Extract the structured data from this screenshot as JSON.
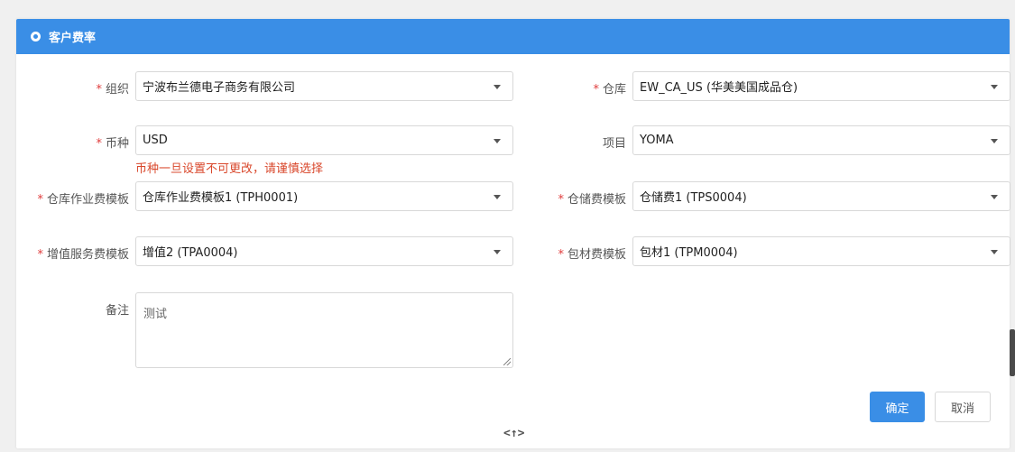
{
  "dialog": {
    "title": "客户费率",
    "icon": "circle-logo-icon"
  },
  "form": {
    "org": {
      "label": "组织",
      "required": true,
      "value": "宁波布兰德电子商务有限公司"
    },
    "warehouse": {
      "label": "仓库",
      "required": true,
      "value": "EW_CA_US (华美美国成品仓)"
    },
    "currency": {
      "label": "币种",
      "required": true,
      "value": "USD",
      "hint": "币种一旦设置不可更改，请谨慎选择"
    },
    "project": {
      "label": "项目",
      "required": false,
      "value": "YOMA"
    },
    "op_template": {
      "label": "仓库作业费模板",
      "required": true,
      "value": "仓库作业费模板1 (TPH0001)"
    },
    "storage_template": {
      "label": "仓储费模板",
      "required": true,
      "value": "仓储费1 (TPS0004)"
    },
    "vas_template": {
      "label": "增值服务费模板",
      "required": true,
      "value": "增值2 (TPA0004)"
    },
    "packing_template": {
      "label": "包材费模板",
      "required": true,
      "value": "包材1 (TPM0004)"
    },
    "remark": {
      "label": "备注",
      "value": "测试"
    },
    "required_mark": "*"
  },
  "buttons": {
    "confirm": "确定",
    "cancel": "取消"
  },
  "collapse_glyph": "<↑>",
  "colors": {
    "primary": "#3a8ee6",
    "required": "#e03c3c",
    "hint": "#d9472b"
  }
}
